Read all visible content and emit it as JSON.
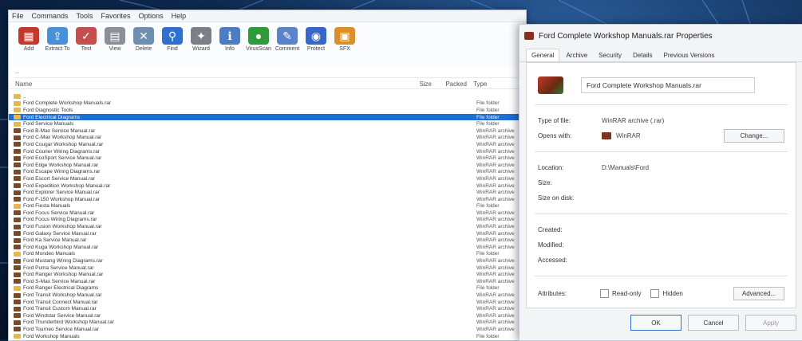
{
  "file_manager": {
    "menu": [
      "File",
      "Commands",
      "Tools",
      "Favorites",
      "Options",
      "Help"
    ],
    "toolbar": [
      {
        "label": "Add",
        "icon": "add-icon",
        "color": "#c0392b"
      },
      {
        "label": "Extract To",
        "icon": "extract-icon",
        "color": "#4a90d9"
      },
      {
        "label": "Test",
        "icon": "test-icon",
        "color": "#c44d4d"
      },
      {
        "label": "View",
        "icon": "view-icon",
        "color": "#8a8f99"
      },
      {
        "label": "Delete",
        "icon": "delete-icon",
        "color": "#6f8fb0"
      },
      {
        "label": "Find",
        "icon": "find-icon",
        "color": "#2f6fd0"
      },
      {
        "label": "Wizard",
        "icon": "wizard-icon",
        "color": "#7a7f88"
      },
      {
        "label": "Info",
        "icon": "info-icon",
        "color": "#4c7cc4"
      },
      {
        "label": "VirusScan",
        "icon": "virusscan-icon",
        "color": "#2e9b3a"
      },
      {
        "label": "Comment",
        "icon": "comment-icon",
        "color": "#5b83c9"
      },
      {
        "label": "Protect",
        "icon": "protect-icon",
        "color": "#3766c8"
      },
      {
        "label": "SFX",
        "icon": "sfx-icon",
        "color": "#d9902b"
      }
    ],
    "path": "..",
    "columns": {
      "name": "Name",
      "size": "Size",
      "packed": "Packed",
      "type": "Type"
    },
    "sub_type_header": "File folder",
    "rows": [
      {
        "name": "..",
        "size": "",
        "packed": "",
        "type": "",
        "kind": "folder"
      },
      {
        "name": "Ford Complete Workshop Manuals.rar",
        "size": "",
        "packed": "",
        "type": "File folder",
        "kind": "folder"
      },
      {
        "name": "Ford Diagnostic Tools",
        "size": "",
        "packed": "",
        "type": "File folder",
        "kind": "folder"
      },
      {
        "name": "Ford Electrical Diagrams",
        "size": "",
        "packed": "",
        "type": "File folder",
        "kind": "folder",
        "selected": true
      },
      {
        "name": "Ford Service Manuals",
        "size": "",
        "packed": "",
        "type": "File folder",
        "kind": "folder"
      },
      {
        "name": "Ford B-Max Service Manual.rar",
        "size": "",
        "packed": "",
        "type": "WinRAR archive",
        "kind": "file"
      },
      {
        "name": "Ford C-Max Workshop Manual.rar",
        "size": "",
        "packed": "",
        "type": "WinRAR archive",
        "kind": "file"
      },
      {
        "name": "Ford Cougar Workshop Manual.rar",
        "size": "",
        "packed": "",
        "type": "WinRAR archive",
        "kind": "file"
      },
      {
        "name": "Ford Courier Wiring Diagrams.rar",
        "size": "",
        "packed": "",
        "type": "WinRAR archive",
        "kind": "file"
      },
      {
        "name": "Ford EcoSport Service Manual.rar",
        "size": "",
        "packed": "",
        "type": "WinRAR archive",
        "kind": "file"
      },
      {
        "name": "Ford Edge Workshop Manual.rar",
        "size": "",
        "packed": "",
        "type": "WinRAR archive",
        "kind": "file"
      },
      {
        "name": "Ford Escape Wiring Diagrams.rar",
        "size": "",
        "packed": "",
        "type": "WinRAR archive",
        "kind": "file"
      },
      {
        "name": "Ford Escort Service Manual.rar",
        "size": "",
        "packed": "",
        "type": "WinRAR archive",
        "kind": "file"
      },
      {
        "name": "Ford Expedition Workshop Manual.rar",
        "size": "",
        "packed": "",
        "type": "WinRAR archive",
        "kind": "file"
      },
      {
        "name": "Ford Explorer Service Manual.rar",
        "size": "",
        "packed": "",
        "type": "WinRAR archive",
        "kind": "file"
      },
      {
        "name": "Ford F-150 Workshop Manual.rar",
        "size": "",
        "packed": "",
        "type": "WinRAR archive",
        "kind": "file"
      },
      {
        "name": "Ford Fiesta Manuals",
        "size": "",
        "packed": "",
        "type": "File folder",
        "kind": "folder"
      },
      {
        "name": "Ford Focus Service Manual.rar",
        "size": "",
        "packed": "",
        "type": "WinRAR archive",
        "kind": "file"
      },
      {
        "name": "Ford Focus Wiring Diagrams.rar",
        "size": "",
        "packed": "",
        "type": "WinRAR archive",
        "kind": "file"
      },
      {
        "name": "Ford Fusion Workshop Manual.rar",
        "size": "",
        "packed": "",
        "type": "WinRAR archive",
        "kind": "file"
      },
      {
        "name": "Ford Galaxy Service Manual.rar",
        "size": "",
        "packed": "",
        "type": "WinRAR archive",
        "kind": "file"
      },
      {
        "name": "Ford Ka Service Manual.rar",
        "size": "",
        "packed": "",
        "type": "WinRAR archive",
        "kind": "file"
      },
      {
        "name": "Ford Kuga Workshop Manual.rar",
        "size": "",
        "packed": "",
        "type": "WinRAR archive",
        "kind": "file"
      },
      {
        "name": "Ford Mondeo Manuals",
        "size": "",
        "packed": "",
        "type": "File folder",
        "kind": "folder"
      },
      {
        "name": "Ford Mustang Wiring Diagrams.rar",
        "size": "",
        "packed": "",
        "type": "WinRAR archive",
        "kind": "file"
      },
      {
        "name": "Ford Puma Service Manual.rar",
        "size": "",
        "packed": "",
        "type": "WinRAR archive",
        "kind": "file"
      },
      {
        "name": "Ford Ranger Workshop Manual.rar",
        "size": "",
        "packed": "",
        "type": "WinRAR archive",
        "kind": "file"
      },
      {
        "name": "Ford S-Max Service Manual.rar",
        "size": "",
        "packed": "",
        "type": "WinRAR archive",
        "kind": "file"
      },
      {
        "name": "Ford Ranger Electrical Diagrams",
        "size": "",
        "packed": "",
        "type": "File folder",
        "kind": "folder"
      },
      {
        "name": "Ford Transit Workshop Manual.rar",
        "size": "",
        "packed": "",
        "type": "WinRAR archive",
        "kind": "file"
      },
      {
        "name": "Ford Transit Connect Manual.rar",
        "size": "",
        "packed": "",
        "type": "WinRAR archive",
        "kind": "file"
      },
      {
        "name": "Ford Transit Custom Manual.rar",
        "size": "",
        "packed": "",
        "type": "WinRAR archive",
        "kind": "file"
      },
      {
        "name": "Ford Windstar Service Manual.rar",
        "size": "",
        "packed": "",
        "type": "WinRAR archive",
        "kind": "file"
      },
      {
        "name": "Ford Thunderbird Workshop Manual.rar",
        "size": "",
        "packed": "",
        "type": "WinRAR archive",
        "kind": "file"
      },
      {
        "name": "Ford Tourneo Service Manual.rar",
        "size": "",
        "packed": "",
        "type": "WinRAR archive",
        "kind": "file"
      },
      {
        "name": "Ford Workshop Manuals",
        "size": "",
        "packed": "",
        "type": "File folder",
        "kind": "folder"
      }
    ]
  },
  "properties": {
    "title": "Ford Complete Workshop Manuals.rar Properties",
    "tabs": [
      "General",
      "Archive",
      "Security",
      "Details",
      "Previous Versions"
    ],
    "active_tab": "General",
    "file_name": "Ford Complete Workshop Manuals.rar",
    "type_label": "Type of file:",
    "type_value": "WinRAR archive (.rar)",
    "opens_label": "Opens with:",
    "opens_value": "WinRAR",
    "change_label": "Change...",
    "location_label": "Location:",
    "location_value": "D:\\Manuals\\Ford",
    "size_label": "Size:",
    "size_value": "",
    "size_on_disk_label": "Size on disk:",
    "size_on_disk_value": "",
    "created_label": "Created:",
    "created_value": "",
    "modified_label": "Modified:",
    "modified_value": "",
    "accessed_label": "Accessed:",
    "accessed_value": "",
    "attributes_label": "Attributes:",
    "readonly_label": "Read-only",
    "hidden_label": "Hidden",
    "advanced_label": "Advanced...",
    "ok_label": "OK",
    "cancel_label": "Cancel",
    "apply_label": "Apply"
  },
  "status_bar": {
    "left": "",
    "right": ""
  },
  "colors": {
    "selection": "#1d6fd6",
    "desktop": "#0e2a50"
  }
}
